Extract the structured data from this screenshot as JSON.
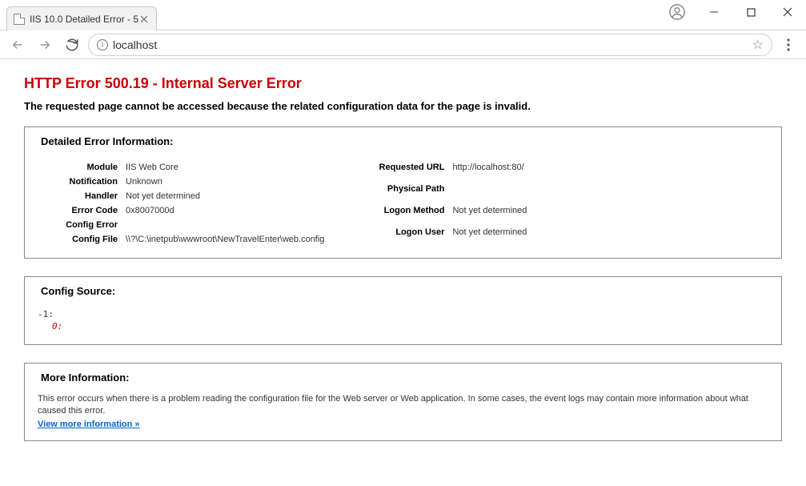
{
  "window": {
    "tab_title": "IIS 10.0 Detailed Error - 5"
  },
  "toolbar": {
    "url": "localhost"
  },
  "page": {
    "heading": "HTTP Error 500.19 - Internal Server Error",
    "subheading": "The requested page cannot be accessed because the related configuration data for the page is invalid.",
    "sections": {
      "details": {
        "title": "Detailed Error Information:",
        "left": [
          {
            "label": "Module",
            "value": "IIS Web Core"
          },
          {
            "label": "Notification",
            "value": "Unknown"
          },
          {
            "label": "Handler",
            "value": "Not yet determined"
          },
          {
            "label": "Error Code",
            "value": "0x8007000d"
          },
          {
            "label": "Config Error",
            "value": ""
          },
          {
            "label": "Config File",
            "value": "\\\\?\\C:\\inetpub\\wwwroot\\NewTravelEnter\\web.config"
          }
        ],
        "right": [
          {
            "label": "Requested URL",
            "value": "http://localhost:80/"
          },
          {
            "label": "Physical Path",
            "value": ""
          },
          {
            "label": "Logon Method",
            "value": "Not yet determined"
          },
          {
            "label": "Logon User",
            "value": "Not yet determined"
          }
        ]
      },
      "config_source": {
        "title": "Config Source:",
        "line1": "-1:",
        "line2": "0:"
      },
      "more_info": {
        "title": "More Information:",
        "text": "This error occurs when there is a problem reading the configuration file for the Web server or Web application. In some cases, the event logs may contain more information about what caused this error.",
        "link_text": "View more information »"
      }
    }
  }
}
